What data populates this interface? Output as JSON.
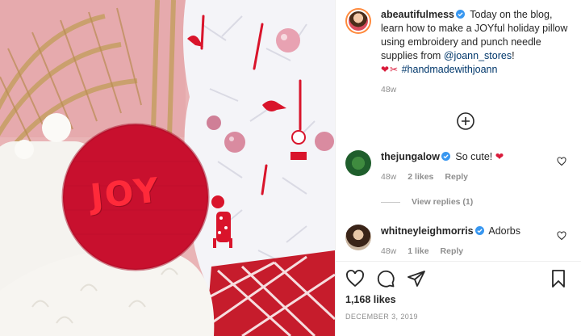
{
  "post": {
    "photo": {
      "pillow_text": "JOY"
    },
    "caption": {
      "username": "abeautifulmess",
      "text_1": " Today on the blog, learn how to make a JOYful holiday pillow using embroidery and punch needle supplies from ",
      "mention": "@joann_stores",
      "text_2": "!",
      "emoji": "❤✂",
      "hashtag": "#handmadewithjoann",
      "time": "48w"
    },
    "comments": [
      {
        "username": "thejungalow",
        "text": " So cute! ",
        "emoji": "❤",
        "time": "48w",
        "likes": "2 likes",
        "reply": "Reply"
      },
      {
        "username": "whitneyleighmorris",
        "text": " Adorbs",
        "time": "48w",
        "likes": "1 like",
        "reply": "Reply"
      }
    ],
    "view_replies": "View replies (1)",
    "likes_count": "1,168 likes",
    "date": "DECEMBER 3, 2019",
    "colors": {
      "verified": "#3897f0",
      "heart": "#ed4956",
      "link": "#00376b",
      "pillow": "#c8102e"
    },
    "icons": [
      "verified-icon",
      "load-more-icon",
      "heart-icon",
      "comment-icon",
      "share-icon",
      "bookmark-icon"
    ]
  }
}
